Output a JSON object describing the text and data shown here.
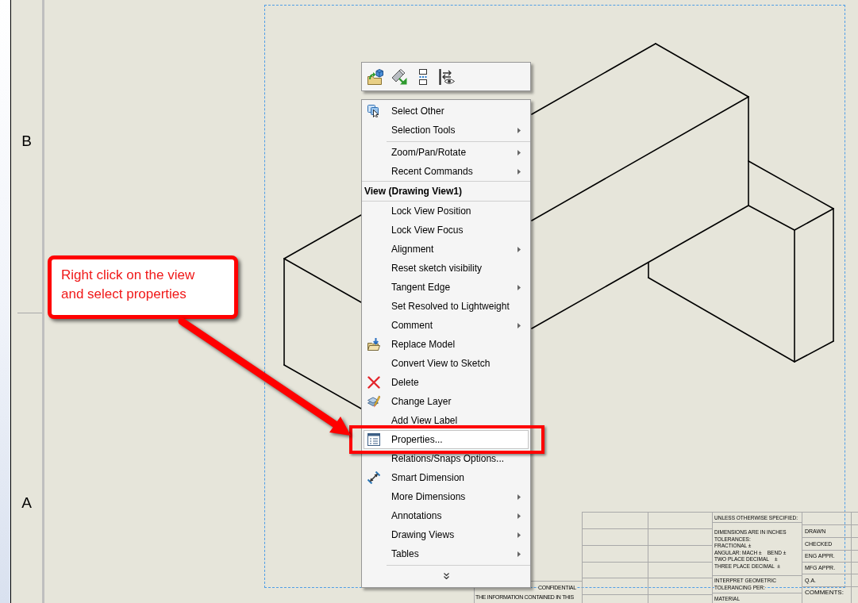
{
  "sheet": {
    "zone_labels": [
      "B",
      "A"
    ]
  },
  "callout": {
    "text": "Right click on the view and select properties"
  },
  "context_menu": {
    "items": [
      {
        "kind": "item",
        "label": "Select Other",
        "submenu": false,
        "selected": false
      },
      {
        "kind": "item",
        "label": "Selection Tools",
        "submenu": true,
        "selected": false
      },
      {
        "kind": "separator"
      },
      {
        "kind": "item",
        "label": "Zoom/Pan/Rotate",
        "submenu": true,
        "selected": false
      },
      {
        "kind": "item",
        "label": "Recent Commands",
        "submenu": true,
        "selected": false
      },
      {
        "kind": "header",
        "label": "View (Drawing View1)"
      },
      {
        "kind": "item",
        "label": "Lock View Position",
        "submenu": false,
        "selected": false
      },
      {
        "kind": "item",
        "label": "Lock View Focus",
        "submenu": false,
        "selected": false
      },
      {
        "kind": "item",
        "label": "Alignment",
        "submenu": true,
        "selected": false
      },
      {
        "kind": "item",
        "label": "Reset sketch visibility",
        "submenu": false,
        "selected": false
      },
      {
        "kind": "item",
        "label": "Tangent Edge",
        "submenu": true,
        "selected": false
      },
      {
        "kind": "item",
        "label": "Set Resolved to Lightweight",
        "submenu": false,
        "selected": false
      },
      {
        "kind": "item",
        "label": "Comment",
        "submenu": true,
        "selected": false
      },
      {
        "kind": "item",
        "label": "Replace Model",
        "submenu": false,
        "selected": false
      },
      {
        "kind": "item",
        "label": "Convert View to Sketch",
        "submenu": false,
        "selected": false
      },
      {
        "kind": "item",
        "label": "Delete",
        "submenu": false,
        "selected": false
      },
      {
        "kind": "item",
        "label": "Change Layer",
        "submenu": false,
        "selected": false
      },
      {
        "kind": "item",
        "label": "Add View Label",
        "submenu": false,
        "selected": false
      },
      {
        "kind": "item",
        "label": "Properties...",
        "submenu": false,
        "selected": true
      },
      {
        "kind": "item",
        "label": "Relations/Snaps Options...",
        "submenu": false,
        "selected": false
      },
      {
        "kind": "item",
        "label": "Smart Dimension",
        "submenu": false,
        "selected": false
      },
      {
        "kind": "item",
        "label": "More Dimensions",
        "submenu": true,
        "selected": false
      },
      {
        "kind": "item",
        "label": "Annotations",
        "submenu": true,
        "selected": false
      },
      {
        "kind": "item",
        "label": "Drawing Views",
        "submenu": true,
        "selected": false
      },
      {
        "kind": "item",
        "label": "Tables",
        "submenu": true,
        "selected": false
      },
      {
        "kind": "separator"
      },
      {
        "kind": "more"
      }
    ]
  },
  "title_block": {
    "confidentiality": [
      "CONFIDENTIAL",
      "THE INFORMATION CONTAINED IN THIS"
    ],
    "specification_heading": "UNLESS OTHERWISE SPECIFIED:",
    "tolerances": [
      "DIMENSIONS ARE IN INCHES",
      "TOLERANCES:",
      "FRACTIONAL ±",
      "ANGULAR: MACH ±    BEND ±",
      "TWO PLACE DECIMAL    ±",
      "THREE PLACE DECIMAL  ±"
    ],
    "geometric_note": [
      "INTERPRET GEOMETRIC",
      "TOLERANCING PER:"
    ],
    "material": "MATERIAL",
    "approvals": [
      "DRAWN",
      "CHECKED",
      "ENG APPR.",
      "MFG APPR.",
      "Q.A."
    ],
    "comments": "COMMENTS:"
  }
}
